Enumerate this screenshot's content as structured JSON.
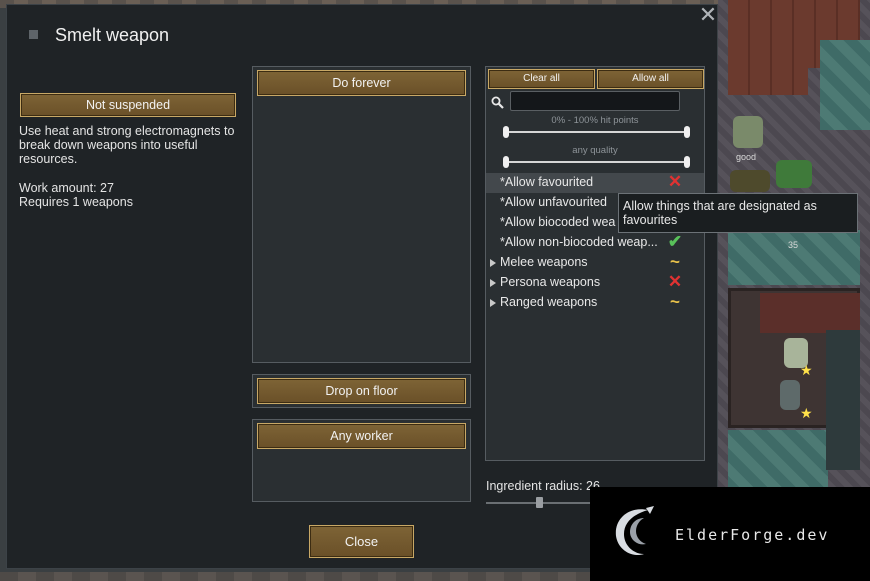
{
  "dialog": {
    "title": "Smelt weapon",
    "close_label": "Close",
    "suspend_label": "Not suspended",
    "description": "Use heat and strong electromagnets to break down weapons into useful resources.",
    "work_amount": "Work amount: 27",
    "requires": "Requires 1 weapons",
    "repeat_mode_label": "Do forever",
    "store_mode_label": "Drop on floor",
    "worker_label": "Any worker",
    "ingredient_radius_label": "Ingredient radius: 26",
    "ingredient_radius_value": 26
  },
  "filter": {
    "clear_all_label": "Clear all",
    "allow_all_label": "Allow all",
    "search_value": "",
    "hitpoints_label": "0% - 100% hit points",
    "quality_label": "any quality",
    "items": [
      {
        "label": "*Allow favourited",
        "state": "disallowed",
        "expandable": false
      },
      {
        "label": "*Allow unfavourited",
        "state": "none",
        "expandable": false
      },
      {
        "label": "*Allow biocoded wea",
        "state": "none",
        "expandable": false
      },
      {
        "label": "*Allow non-biocoded weap...",
        "state": "allowed",
        "expandable": false
      },
      {
        "label": "Melee weapons",
        "state": "partial",
        "expandable": true
      },
      {
        "label": "Persona weapons",
        "state": "disallowed",
        "expandable": true
      },
      {
        "label": "Ranged weapons",
        "state": "partial",
        "expandable": true
      }
    ]
  },
  "tooltip": {
    "text": "Allow things that are designated as favourites"
  },
  "map": {
    "labels": [
      "good",
      "35"
    ]
  },
  "watermark": {
    "text": "ElderForge.dev"
  },
  "colors": {
    "button_fill": "#7e6436",
    "button_border": "#c8a866",
    "allowed": "#59c15a",
    "disallowed": "#e03232",
    "partial": "#e9c24a"
  }
}
